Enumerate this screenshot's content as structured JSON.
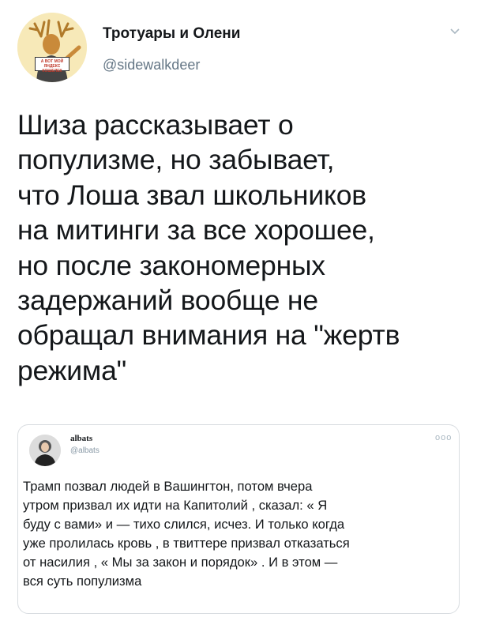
{
  "tweet": {
    "author_name": "Тротуары и Олени",
    "author_handle": "@sidewalkdeer",
    "avatar_sign_lines": [
      "А ВОТ МОЙ",
      "ЯНДЕКС КОШЕЛЕК"
    ],
    "text_lines": [
      "Шиза рассказывает о",
      "популизме, но забывает,",
      "что Лоша звал школьников",
      "на митинги за все хорошее,",
      "но после закономерных",
      "задержаний вообще не",
      "обращал внимания на \"жертв",
      "режима\""
    ]
  },
  "quoted": {
    "author_name": "albats",
    "author_handle": "@albats",
    "more_label": "ooo",
    "text_lines": [
      "Трамп позвал людей в Вашингтон, потом вчера",
      "утром призвал их идти на Капитолий , сказал: « Я",
      "буду с вами» и — тихо слился, исчез. И только когда",
      "уже пролилась кровь , в твиттере призвал отказаться",
      "от насилия , « Мы за закон и порядок» . И в этом —",
      "вся суть популизма"
    ]
  },
  "colors": {
    "text": "#14171a",
    "secondary": "#657786",
    "border": "#d9dde1",
    "avatar_bg": "#f7e9b8"
  },
  "icons": {
    "caret": "chevron-down-icon",
    "more": "more-icon"
  }
}
